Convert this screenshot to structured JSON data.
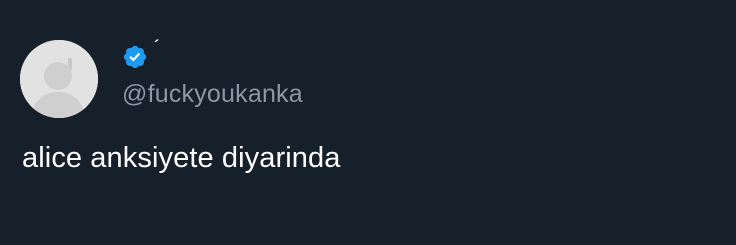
{
  "tweet": {
    "author": {
      "display_name": "´",
      "handle": "@fuckyoukanka",
      "verified": true,
      "avatar": "default-profile-avatar"
    },
    "text": "alice anksiyete diyarinda"
  },
  "colors": {
    "background": "#15202b",
    "verified_badge": "#1d9bf0",
    "handle_text": "#8b98a5",
    "body_text": "#ffffff"
  }
}
